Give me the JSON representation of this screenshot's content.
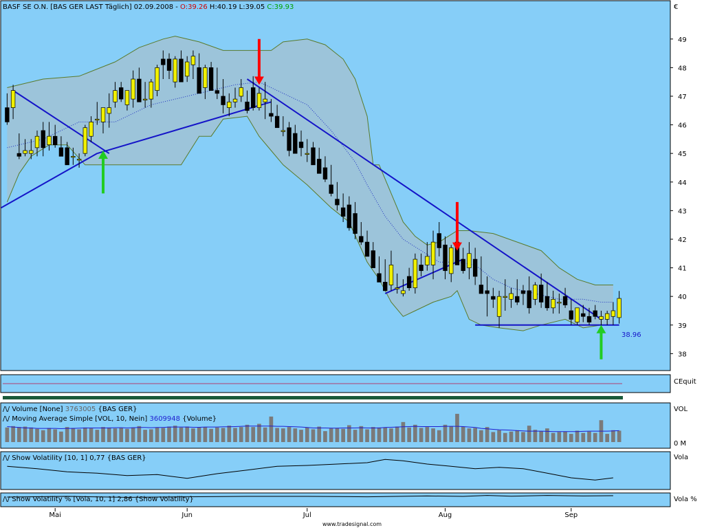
{
  "colors": {
    "panel_bg": "#86CEF8",
    "band_fill": "#9CC4DA",
    "band_line": "#5A7A2A",
    "up_candle": "#F0F000",
    "down_candle": "#000000",
    "trendline": "#1414C8",
    "volume_bar": "#7A7A7A",
    "volume_ma": "#1E1ED0",
    "arrow_sell": "#FF0000",
    "arrow_buy": "#22CC22",
    "ohlc_red": "#D00000",
    "ohlc_green": "#00A000"
  },
  "main_header": {
    "symbol": "BASF SE O.N. [BAS GER LAST Täglich] 02.09.2008 - ",
    "open": "O:39.26",
    "high": "H:40.19",
    "low": "L:39.05",
    "close": "C:39.93"
  },
  "currency_label": "€",
  "equity_label": "CEquit",
  "annotations": {
    "support_value": "38.96"
  },
  "indicators": {
    "volume": {
      "name": "Volume [None]",
      "value": "3763005",
      "source": "{BAS GER}",
      "axis_top": "VOL",
      "axis_bottom": "0 M"
    },
    "volume_ma": {
      "name": "Moving Average Simple [VOL, 10, Nein]",
      "value": "3609948",
      "source": "{Volume}"
    },
    "volatility": {
      "label": "Show Volatility [10, 1] 0,77 {BAS GER}",
      "axis": "Vola"
    },
    "volatility_pct": {
      "label": "Show Volatility % [Vola, 10, 1] 2,86 {Show Volatility}",
      "axis": "Vola %"
    }
  },
  "footer": {
    "watermark": "www.tradesignal.com"
  },
  "chart_data": {
    "type": "candlestick",
    "ylim": [
      37.6,
      50.1
    ],
    "yticks": [
      38,
      39,
      40,
      41,
      42,
      43,
      44,
      45,
      46,
      47,
      48,
      49
    ],
    "x_month_labels": [
      {
        "label": "Mai",
        "index": 8
      },
      {
        "label": "Jun",
        "index": 30
      },
      {
        "label": "Jul",
        "index": 50
      },
      {
        "label": "Aug",
        "index": 73
      },
      {
        "label": "Sep",
        "index": 94
      }
    ],
    "candles": [
      [
        46.6,
        47.1,
        46.0,
        46.1
      ],
      [
        46.6,
        47.4,
        46.2,
        47.2
      ],
      [
        45.0,
        45.7,
        44.8,
        44.9
      ],
      [
        45.0,
        45.5,
        44.9,
        45.1
      ],
      [
        45.0,
        45.5,
        44.8,
        45.1
      ],
      [
        45.2,
        45.8,
        44.9,
        45.6
      ],
      [
        45.8,
        46.1,
        44.9,
        45.2
      ],
      [
        45.3,
        46.1,
        45.1,
        45.6
      ],
      [
        45.6,
        46.0,
        45.2,
        45.3
      ],
      [
        45.2,
        45.6,
        44.9,
        44.9
      ],
      [
        45.2,
        45.4,
        44.6,
        44.6
      ],
      [
        44.9,
        45.2,
        44.6,
        44.9
      ],
      [
        44.8,
        45.0,
        44.5,
        44.8
      ],
      [
        45.0,
        46.0,
        44.9,
        45.9
      ],
      [
        45.6,
        46.3,
        45.4,
        46.1
      ],
      [
        46.2,
        46.8,
        46.0,
        46.2
      ],
      [
        46.1,
        46.6,
        45.7,
        46.6
      ],
      [
        46.4,
        47.1,
        45.9,
        46.6
      ],
      [
        46.8,
        47.5,
        46.6,
        47.2
      ],
      [
        47.3,
        47.5,
        46.8,
        46.9
      ],
      [
        46.7,
        47.2,
        46.5,
        47.2
      ],
      [
        46.9,
        47.9,
        46.6,
        47.6
      ],
      [
        47.6,
        48.0,
        46.8,
        46.8
      ],
      [
        46.9,
        47.5,
        46.6,
        46.9
      ],
      [
        46.9,
        47.6,
        46.6,
        47.5
      ],
      [
        47.2,
        48.1,
        47.0,
        48.0
      ],
      [
        48.3,
        48.6,
        47.6,
        48.1
      ],
      [
        48.3,
        48.5,
        47.6,
        47.9
      ],
      [
        47.5,
        48.4,
        47.3,
        48.3
      ],
      [
        48.3,
        48.6,
        47.7,
        47.5
      ],
      [
        47.7,
        48.4,
        47.5,
        48.2
      ],
      [
        48.1,
        48.6,
        47.6,
        48.4
      ],
      [
        48.0,
        48.5,
        47.2,
        47.1
      ],
      [
        47.3,
        48.1,
        46.9,
        48.0
      ],
      [
        48.0,
        48.2,
        47.2,
        47.2
      ],
      [
        47.2,
        48.0,
        46.9,
        47.1
      ],
      [
        47.0,
        47.6,
        46.4,
        46.7
      ],
      [
        46.6,
        47.1,
        46.3,
        46.8
      ],
      [
        46.8,
        47.3,
        46.6,
        46.9
      ],
      [
        47.0,
        47.6,
        46.8,
        47.3
      ],
      [
        46.8,
        47.2,
        46.4,
        46.5
      ],
      [
        47.3,
        47.7,
        46.5,
        46.6
      ],
      [
        46.6,
        47.3,
        46.5,
        47.1
      ],
      [
        46.8,
        47.5,
        46.2,
        46.9
      ],
      [
        46.4,
        46.9,
        46.1,
        46.3
      ],
      [
        46.3,
        46.7,
        45.9,
        45.9
      ],
      [
        45.8,
        46.3,
        45.6,
        45.8
      ],
      [
        45.9,
        46.1,
        44.9,
        45.1
      ],
      [
        45.7,
        46.0,
        45.0,
        45.0
      ],
      [
        45.4,
        45.8,
        44.9,
        45.2
      ],
      [
        45.0,
        45.5,
        44.7,
        45.0
      ],
      [
        45.2,
        45.4,
        44.6,
        44.6
      ],
      [
        44.8,
        45.2,
        44.3,
        44.3
      ],
      [
        44.5,
        44.9,
        44.0,
        44.1
      ],
      [
        43.9,
        44.6,
        43.5,
        43.6
      ],
      [
        43.4,
        44.0,
        43.0,
        43.2
      ],
      [
        43.1,
        43.6,
        42.6,
        42.8
      ],
      [
        43.2,
        43.5,
        42.3,
        42.4
      ],
      [
        42.9,
        43.3,
        42.0,
        42.2
      ],
      [
        42.1,
        42.6,
        41.8,
        41.9
      ],
      [
        41.9,
        42.3,
        41.4,
        41.4
      ],
      [
        41.6,
        41.9,
        41.0,
        41.0
      ],
      [
        40.8,
        41.4,
        40.5,
        40.5
      ],
      [
        40.5,
        41.3,
        40.2,
        40.2
      ],
      [
        40.4,
        41.6,
        40.2,
        41.1
      ],
      [
        40.3,
        40.8,
        40.1,
        40.3
      ],
      [
        40.1,
        40.6,
        40.0,
        40.2
      ],
      [
        40.7,
        41.0,
        40.2,
        40.3
      ],
      [
        40.3,
        41.5,
        40.1,
        41.3
      ],
      [
        41.1,
        41.5,
        40.7,
        40.9
      ],
      [
        41.1,
        41.9,
        40.9,
        41.4
      ],
      [
        41.1,
        42.3,
        40.6,
        41.9
      ],
      [
        42.2,
        42.6,
        41.4,
        41.7
      ],
      [
        41.8,
        42.1,
        40.6,
        40.9
      ],
      [
        40.8,
        41.8,
        40.5,
        41.7
      ],
      [
        41.9,
        42.0,
        41.2,
        41.1
      ],
      [
        41.3,
        41.7,
        40.8,
        40.9
      ],
      [
        41.0,
        41.9,
        40.6,
        41.5
      ],
      [
        41.3,
        41.7,
        40.4,
        40.7
      ],
      [
        40.4,
        41.4,
        40.1,
        40.1
      ],
      [
        40.2,
        40.7,
        39.3,
        40.1
      ],
      [
        40.0,
        40.3,
        39.6,
        39.9
      ],
      [
        39.3,
        40.2,
        38.9,
        40.0
      ],
      [
        40.0,
        40.6,
        39.5,
        40.0
      ],
      [
        39.9,
        40.3,
        39.6,
        40.1
      ],
      [
        40.0,
        40.6,
        39.7,
        39.8
      ],
      [
        40.2,
        40.4,
        39.7,
        40.1
      ],
      [
        40.2,
        40.7,
        39.4,
        39.6
      ],
      [
        39.9,
        40.5,
        39.7,
        40.4
      ],
      [
        40.4,
        40.8,
        39.6,
        39.8
      ],
      [
        40.0,
        40.5,
        39.5,
        39.6
      ],
      [
        39.6,
        40.2,
        39.4,
        39.9
      ],
      [
        39.8,
        40.1,
        39.4,
        39.8
      ],
      [
        40.0,
        40.3,
        39.6,
        39.7
      ],
      [
        39.5,
        39.9,
        39.0,
        39.2
      ],
      [
        39.1,
        39.6,
        39.0,
        39.6
      ],
      [
        39.4,
        39.7,
        39.1,
        39.3
      ],
      [
        39.3,
        39.6,
        39.0,
        39.1
      ],
      [
        39.5,
        39.7,
        39.2,
        39.3
      ],
      [
        39.2,
        39.5,
        38.6,
        39.3
      ],
      [
        39.2,
        39.5,
        39.0,
        39.4
      ],
      [
        39.3,
        39.8,
        39.0,
        39.5
      ],
      [
        39.26,
        40.19,
        39.05,
        39.93
      ]
    ],
    "bollinger_upper": [
      [
        0,
        47.3
      ],
      [
        6,
        47.6
      ],
      [
        12,
        47.7
      ],
      [
        18,
        48.2
      ],
      [
        22,
        48.7
      ],
      [
        26,
        49.0
      ],
      [
        28,
        49.1
      ],
      [
        32,
        48.9
      ],
      [
        36,
        48.6
      ],
      [
        40,
        48.6
      ],
      [
        44,
        48.6
      ],
      [
        46,
        48.9
      ],
      [
        50,
        49.0
      ],
      [
        53,
        48.8
      ],
      [
        56,
        48.3
      ],
      [
        58,
        47.6
      ],
      [
        60,
        46.3
      ],
      [
        61,
        44.6
      ],
      [
        62,
        44.6
      ],
      [
        64,
        43.6
      ],
      [
        66,
        42.6
      ],
      [
        68,
        42.1
      ],
      [
        70,
        41.8
      ],
      [
        72,
        41.9
      ],
      [
        75,
        42.3
      ],
      [
        77,
        42.3
      ],
      [
        81,
        42.2
      ],
      [
        85,
        41.9
      ],
      [
        89,
        41.6
      ],
      [
        92,
        41.0
      ],
      [
        95,
        40.6
      ],
      [
        98,
        40.4
      ],
      [
        101,
        40.4
      ]
    ],
    "bollinger_lower": [
      [
        0,
        43.3
      ],
      [
        2,
        44.3
      ],
      [
        4,
        44.9
      ],
      [
        7,
        45.3
      ],
      [
        10,
        45.3
      ],
      [
        13,
        44.6
      ],
      [
        16,
        44.6
      ],
      [
        20,
        44.6
      ],
      [
        25,
        44.6
      ],
      [
        29,
        44.6
      ],
      [
        32,
        45.6
      ],
      [
        34,
        45.6
      ],
      [
        36,
        46.2
      ],
      [
        40,
        46.3
      ],
      [
        42,
        45.6
      ],
      [
        44,
        45.1
      ],
      [
        46,
        44.6
      ],
      [
        50,
        43.9
      ],
      [
        54,
        43.1
      ],
      [
        57,
        42.6
      ],
      [
        60,
        41.2
      ],
      [
        62,
        40.6
      ],
      [
        64,
        39.8
      ],
      [
        66,
        39.3
      ],
      [
        68,
        39.5
      ],
      [
        71,
        39.8
      ],
      [
        74,
        40.0
      ],
      [
        75,
        40.2
      ],
      [
        77,
        39.2
      ],
      [
        79,
        39.0
      ],
      [
        82,
        38.9
      ],
      [
        86,
        38.8
      ],
      [
        89,
        39.0
      ],
      [
        93,
        39.2
      ],
      [
        96,
        38.9
      ],
      [
        99,
        39.0
      ],
      [
        101,
        39.0
      ]
    ],
    "moving_average": [
      [
        0,
        45.2
      ],
      [
        6,
        45.5
      ],
      [
        12,
        46.1
      ],
      [
        18,
        46.1
      ],
      [
        24,
        46.7
      ],
      [
        30,
        47.0
      ],
      [
        34,
        47.2
      ],
      [
        38,
        47.4
      ],
      [
        42,
        47.5
      ],
      [
        46,
        47.1
      ],
      [
        50,
        46.7
      ],
      [
        54,
        45.8
      ],
      [
        58,
        44.7
      ],
      [
        60,
        43.9
      ],
      [
        63,
        42.8
      ],
      [
        66,
        42.0
      ],
      [
        69,
        41.6
      ],
      [
        72,
        41.2
      ],
      [
        75,
        41.2
      ],
      [
        78,
        41.1
      ],
      [
        81,
        40.6
      ],
      [
        84,
        40.3
      ],
      [
        88,
        40.1
      ],
      [
        92,
        39.9
      ],
      [
        96,
        39.9
      ],
      [
        99,
        39.8
      ],
      [
        101,
        39.8
      ]
    ],
    "trendlines": [
      {
        "from": [
          -1,
          43.1
        ],
        "to": [
          15,
          45.0
        ]
      },
      {
        "from": [
          15,
          45.0
        ],
        "to": [
          44,
          46.8
        ]
      },
      {
        "from": [
          1,
          47.2
        ],
        "to": [
          17,
          45.0
        ]
      },
      {
        "from": [
          40,
          47.6
        ],
        "to": [
          99,
          39.2
        ]
      },
      {
        "from": [
          63,
          40.1
        ],
        "to": [
          76,
          41.3
        ]
      },
      {
        "from": [
          78,
          39.0
        ],
        "to": [
          102,
          39.0
        ]
      }
    ],
    "arrows": [
      {
        "index": 42,
        "y_top": 49.0,
        "y_tip": 47.4,
        "color": "sell"
      },
      {
        "index": 75,
        "y_top": 43.3,
        "y_tip": 41.6,
        "color": "sell"
      },
      {
        "index": 16,
        "y_top": 43.6,
        "y_tip": 45.1,
        "color": "buy"
      },
      {
        "index": 99,
        "y_top": 37.8,
        "y_tip": 39.0,
        "color": "buy"
      }
    ],
    "volume": {
      "ylim": [
        0,
        8000000
      ],
      "bars": [
        3200000,
        3500000,
        3300000,
        3400000,
        3200000,
        2900000,
        2600000,
        3100000,
        2800000,
        2300000,
        3300000,
        3100000,
        2800000,
        3200000,
        3000000,
        2700000,
        3300000,
        3200000,
        3000000,
        3100000,
        2900000,
        3200000,
        3500000,
        2700000,
        2800000,
        3200000,
        3100000,
        3400000,
        3600000,
        3200000,
        3400000,
        3000000,
        3300000,
        3300000,
        2900000,
        3200000,
        3100000,
        3600000,
        3100000,
        3300000,
        3800000,
        3300000,
        4000000,
        3200000,
        5600000,
        3100000,
        3000000,
        3300000,
        3000000,
        2700000,
        3200000,
        2800000,
        3400000,
        2400000,
        3000000,
        3100000,
        2900000,
        3700000,
        2700000,
        3500000,
        2800000,
        3300000,
        3200000,
        3200000,
        3000000,
        3400000,
        4400000,
        3200000,
        3800000,
        3100000,
        3300000,
        3000000,
        2600000,
        3800000,
        3500000,
        6200000,
        3400000,
        3000000,
        3100000,
        2600000,
        3300000,
        2200000,
        2600000,
        2000000,
        2300000,
        2600000,
        2200000,
        3600000,
        2700000,
        2400000,
        3000000,
        2000000,
        2200000,
        2300000,
        1800000,
        2500000,
        2000000,
        2300000,
        2000000,
        4800000,
        1800000,
        2600000,
        2500000
      ],
      "ma": [
        3400000,
        3300000,
        3200000,
        3100000,
        3100000,
        3000000,
        3000000,
        3000000,
        3000000,
        2950000,
        3000000,
        3000000,
        3050000,
        3100000,
        3100000,
        3100000,
        3100000,
        3100000,
        3150000,
        3150000,
        3100000,
        3150000,
        3200000,
        3200000,
        3150000,
        3200000,
        3200000,
        3300000,
        3300000,
        3300000,
        3300000,
        3250000,
        3250000,
        3300000,
        3300000,
        3300000,
        3350000,
        3350000,
        3400000,
        3450000,
        3500000,
        3500000,
        3500000,
        3500000,
        3500000,
        3450000,
        3450000,
        3400000,
        3350000,
        3300000,
        3200000,
        3100000,
        3100000,
        3100000,
        3050000,
        3050000,
        3100000,
        3100000,
        3100000,
        3150000,
        3100000,
        3100000,
        3100000,
        3200000,
        3250000,
        3300000,
        3350000,
        3400000,
        3450000,
        3400000,
        3400000,
        3400000,
        3400000,
        3450000,
        3450000,
        3450000,
        3400000,
        3300000,
        3200000,
        3000000,
        2900000,
        2800000,
        2700000,
        2650000,
        2600000,
        2500000,
        2450000,
        2400000,
        2400000,
        2400000,
        2350000,
        2300000,
        2300000,
        2300000,
        2300000,
        2300000,
        2350000,
        2400000,
        2400000,
        2400000,
        2400000,
        2450000,
        2500000
      ]
    },
    "volatility_curve": [
      [
        0,
        40
      ],
      [
        5,
        35
      ],
      [
        10,
        28
      ],
      [
        15,
        25
      ],
      [
        20,
        20
      ],
      [
        25,
        22
      ],
      [
        30,
        14
      ],
      [
        35,
        24
      ],
      [
        40,
        32
      ],
      [
        45,
        40
      ],
      [
        50,
        42
      ],
      [
        55,
        45
      ],
      [
        60,
        48
      ],
      [
        63,
        55
      ],
      [
        66,
        52
      ],
      [
        70,
        45
      ],
      [
        74,
        40
      ],
      [
        78,
        35
      ],
      [
        82,
        38
      ],
      [
        86,
        35
      ],
      [
        90,
        25
      ],
      [
        94,
        15
      ],
      [
        98,
        10
      ],
      [
        101,
        15
      ]
    ],
    "volatility_pct_curve": [
      [
        0,
        40
      ],
      [
        10,
        45
      ],
      [
        20,
        38
      ],
      [
        30,
        42
      ],
      [
        40,
        45
      ],
      [
        50,
        45
      ],
      [
        60,
        42
      ],
      [
        70,
        48
      ],
      [
        76,
        45
      ],
      [
        80,
        52
      ],
      [
        84,
        46
      ],
      [
        90,
        52
      ],
      [
        96,
        48
      ],
      [
        101,
        50
      ]
    ]
  }
}
